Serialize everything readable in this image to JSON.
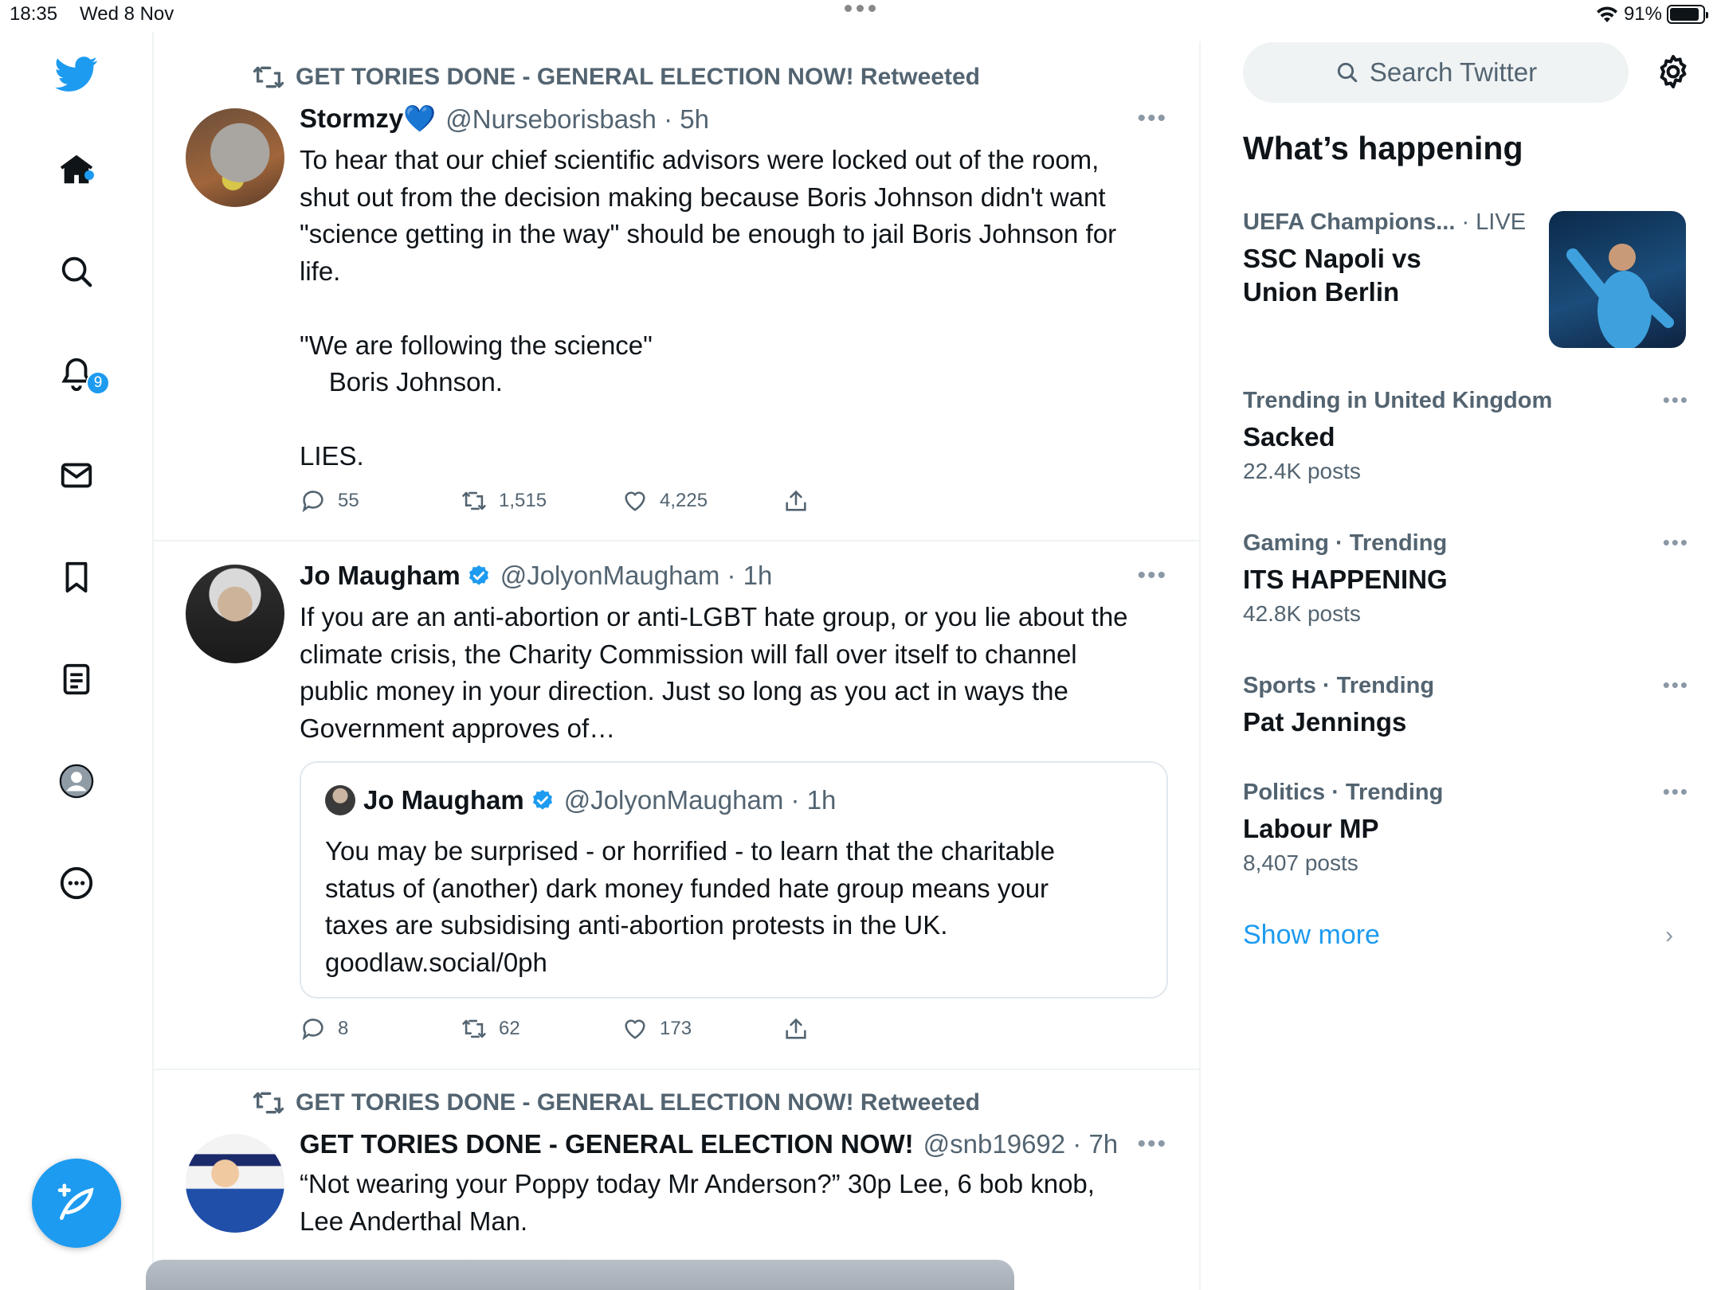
{
  "status_bar": {
    "time": "18:35",
    "date": "Wed 8 Nov",
    "battery": "91%"
  },
  "nav": {
    "items": [
      "twitter-logo",
      "home",
      "explore",
      "notifications",
      "messages",
      "bookmarks",
      "lists",
      "profile",
      "more"
    ],
    "notifications_badge": "9"
  },
  "tweets": [
    {
      "retweet_label": "GET TORIES DONE - GENERAL ELECTION NOW! Retweeted",
      "name": "Stormzy💙",
      "handle": "@Nurseborisbash · 5h",
      "text": "To hear that our chief scientific advisors were locked out of the room,\nshut out from the decision making because Boris Johnson didn't want\n\"science getting in the way\" should be enough to jail Boris Johnson for\nlife.\n\n\"We are following the science\"\n    Boris Johnson.\n\nLIES.",
      "replies": "55",
      "retweets": "1,515",
      "likes": "4,225"
    },
    {
      "name": "Jo Maugham",
      "handle": "@JolyonMaugham · 1h",
      "text": "If you are an anti-abortion or anti-LGBT hate group, or you lie about the\nclimate crisis, the Charity Commission will fall over itself to channel\npublic money in your direction. Just so long as you act in ways the\nGovernment approves of…",
      "quote": {
        "name": "Jo Maugham",
        "handle": "@JolyonMaugham · 1h",
        "text": "You may be surprised - or horrified - to learn that the charitable\nstatus of (another) dark money funded hate group means your\ntaxes are subsidising anti-abortion protests in the UK.\ngoodlaw.social/0ph"
      },
      "replies": "8",
      "retweets": "62",
      "likes": "173"
    },
    {
      "retweet_label": "GET TORIES DONE - GENERAL ELECTION NOW! Retweeted",
      "name": "GET TORIES DONE - GENERAL ELECTION NOW!",
      "handle": "@snb19692 · 7h",
      "text": "“Not wearing your Poppy today Mr Anderson?” 30p Lee, 6 bob knob,\nLee Anderthal Man."
    }
  ],
  "sidebar": {
    "search_placeholder": "Search Twitter",
    "whats_happening": "What’s happening",
    "trends": [
      {
        "category": "UEFA Champions...",
        "extra": " · LIVE",
        "name": "SSC Napoli vs\nUnion Berlin",
        "count": ""
      },
      {
        "category": "Trending in United Kingdom",
        "extra": "",
        "name": "Sacked",
        "count": "22.4K posts"
      },
      {
        "category": "Gaming · Trending",
        "extra": "",
        "name": "ITS HAPPENING",
        "count": "42.8K posts"
      },
      {
        "category": "Sports · Trending",
        "extra": "",
        "name": "Pat Jennings",
        "count": ""
      },
      {
        "category": "Politics · Trending",
        "extra": "",
        "name": "Labour MP",
        "count": "8,407 posts"
      }
    ],
    "show_more": "Show more"
  },
  "colors": {
    "accent": "#1d9bf0",
    "text": "#0f1419",
    "muted": "#536471"
  }
}
